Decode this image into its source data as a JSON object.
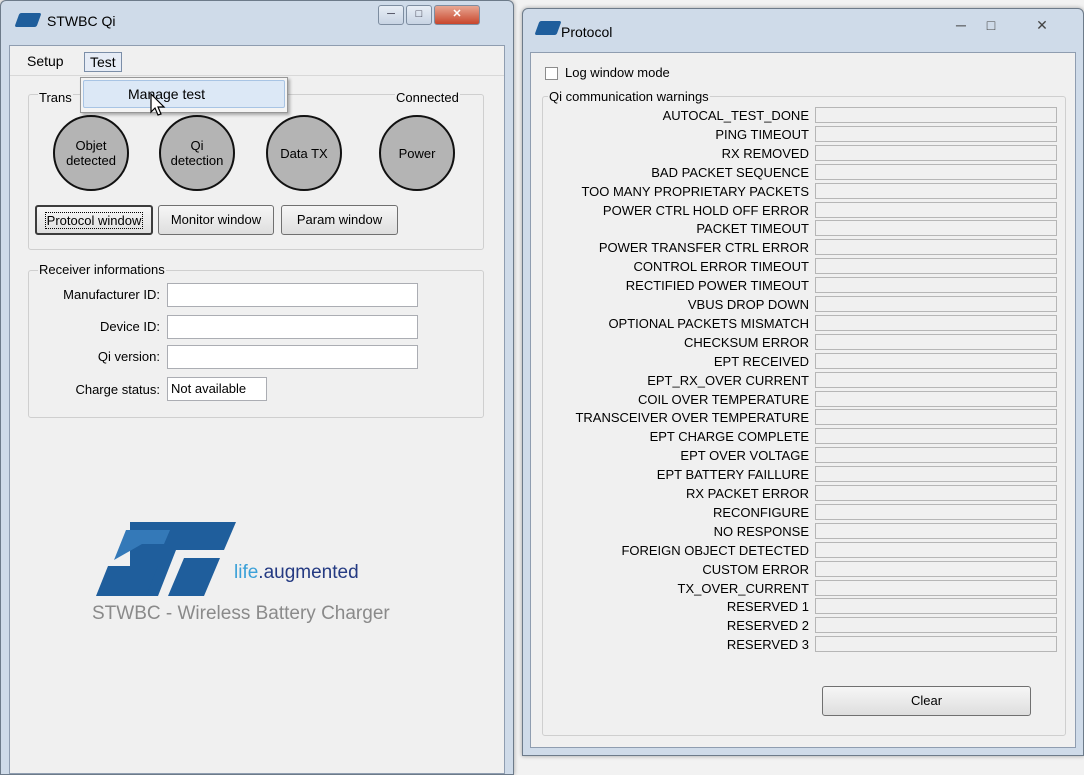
{
  "main_window": {
    "title": "STWBC Qi",
    "menu": [
      "Setup",
      "Test"
    ],
    "popup_item": "Manage test",
    "transmitter": {
      "legend": "Trans",
      "status": "Connected",
      "indicators": [
        "Objet\ndetected",
        "Qi\ndetection",
        "Data TX",
        "Power"
      ]
    },
    "buttons": [
      "Protocol window",
      "Monitor window",
      "Param window"
    ],
    "receiver": {
      "legend": "Receiver informations",
      "manufacturer_label": "Manufacturer ID:",
      "manufacturer_value": "",
      "device_label": "Device ID:",
      "device_value": "",
      "qi_version_label": "Qi version:",
      "qi_version_value": "",
      "charge_label": "Charge status:",
      "charge_value": "Not available"
    },
    "brand": {
      "life": "life",
      "augmented": ".augmented",
      "tagline": "STWBC - Wireless Battery Charger"
    }
  },
  "protocol_window": {
    "title": "Protocol",
    "log_mode_label": "Log window mode",
    "log_mode_checked": false,
    "group_title": "Qi communication warnings",
    "warnings": [
      "AUTOCAL_TEST_DONE",
      "PING TIMEOUT",
      "RX REMOVED",
      "BAD PACKET SEQUENCE",
      "TOO MANY PROPRIETARY PACKETS",
      "POWER CTRL HOLD OFF ERROR",
      "PACKET TIMEOUT",
      "POWER TRANSFER CTRL ERROR",
      "CONTROL ERROR TIMEOUT",
      "RECTIFIED POWER TIMEOUT",
      "VBUS DROP DOWN",
      "OPTIONAL PACKETS MISMATCH",
      "CHECKSUM ERROR",
      "EPT RECEIVED",
      "EPT_RX_OVER CURRENT",
      "COIL OVER TEMPERATURE",
      "TRANSCEIVER OVER TEMPERATURE",
      "EPT CHARGE COMPLETE",
      "EPT OVER VOLTAGE",
      "EPT BATTERY FAILLURE",
      "RX PACKET ERROR",
      "RECONFIGURE",
      "NO RESPONSE",
      "FOREIGN OBJECT DETECTED",
      "CUSTOM ERROR",
      "TX_OVER_CURRENT",
      "RESERVED 1",
      "RESERVED 2",
      "RESERVED 3"
    ],
    "clear_label": "Clear"
  },
  "colors": {
    "frame": "#cfdbe9",
    "indicator": "#b4b4b4",
    "brand_blue": "#1f5e9c"
  }
}
